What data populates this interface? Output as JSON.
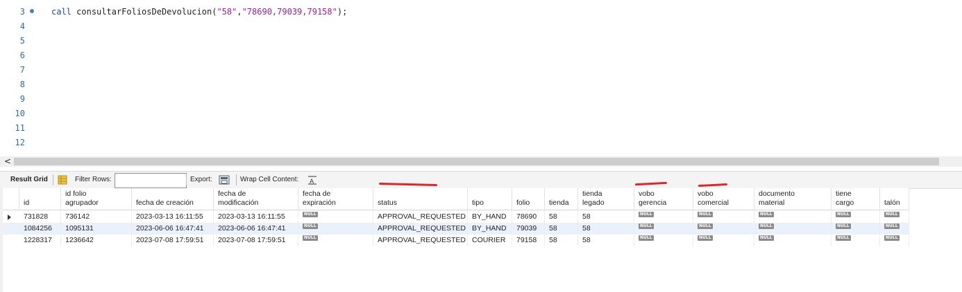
{
  "editor": {
    "line_numbers": [
      "3",
      "4",
      "5",
      "6",
      "7",
      "8",
      "9",
      "10",
      "11",
      "12"
    ],
    "code_keyword": "call",
    "code_function": "consultarFoliosDeDevolucion(",
    "code_arg1": "\"58\"",
    "code_comma": ",",
    "code_arg2": "\"78690,79039,79158\"",
    "code_end": ");",
    "scroll_left": "<"
  },
  "toolbar": {
    "result_grid": "Result Grid",
    "filter_rows": "Filter Rows:",
    "filter_value": "",
    "export": "Export:",
    "wrap": "Wrap Cell Content:"
  },
  "grid": {
    "columns": [
      "id",
      "id folio\nagrupador",
      "fecha de creación",
      "fecha de\nmodificación",
      "fecha de\nexpiración",
      "status",
      "tipo",
      "folio",
      "tienda",
      "tienda\nlegado",
      "vobo\ngerencia",
      "vobo\ncomercial",
      "documento\nmaterial",
      "tiene\ncargo",
      "talón"
    ],
    "null_label": "NULL",
    "rows": [
      [
        "731828",
        "736142",
        "2023-03-13 16:11:55",
        "2023-03-13 16:11:55",
        "NULL",
        "APPROVAL_REQUESTED",
        "BY_HAND",
        "78690",
        "58",
        "58",
        "NULL",
        "NULL",
        "NULL",
        "NULL",
        "NULL"
      ],
      [
        "1084256",
        "1095131",
        "2023-06-06 16:47:41",
        "2023-06-06 16:47:41",
        "NULL",
        "APPROVAL_REQUESTED",
        "BY_HAND",
        "79039",
        "58",
        "58",
        "NULL",
        "NULL",
        "NULL",
        "NULL",
        "NULL"
      ],
      [
        "1228317",
        "1236642",
        "2023-07-08 17:59:51",
        "2023-07-08 17:59:51",
        "NULL",
        "APPROVAL_REQUESTED",
        "COURIER",
        "79158",
        "58",
        "58",
        "NULL",
        "NULL",
        "NULL",
        "NULL",
        "NULL"
      ]
    ]
  },
  "colors": {
    "keyword": "#1c46b0",
    "string": "#9b1aa6",
    "line_number": "#2b6cb0",
    "annotation": "#e0242a",
    "row_alt": "#eaf1fb"
  }
}
